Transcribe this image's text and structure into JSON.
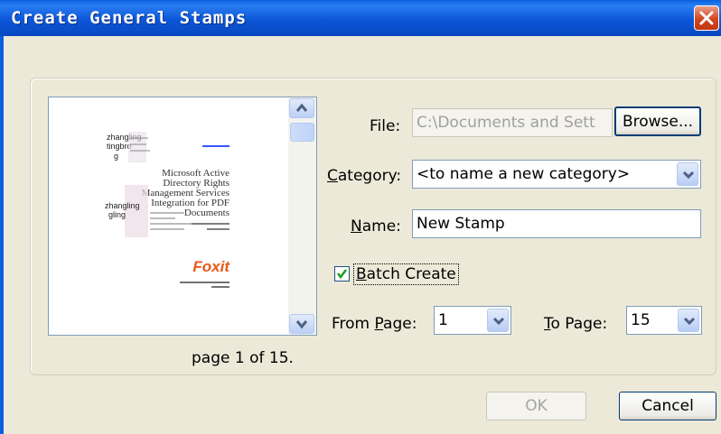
{
  "window": {
    "title": "Create General Stamps"
  },
  "preview": {
    "page_caption": "page 1 of  15.",
    "thumb_texts": {
      "name1": "zhangling",
      "name2": "tingbro",
      "name3": "g",
      "heading": [
        "Microsoft Active",
        "Directory Rights",
        "Management Services",
        "Integration for PDF",
        "Documents"
      ],
      "name4": "zhangling",
      "name5": "gling",
      "logo": "Foxit"
    }
  },
  "form": {
    "file_label": "File:",
    "file_value": "C:\\Documents and Sett",
    "browse_label": "Browse...",
    "category_label_pre": "",
    "category_label_u": "C",
    "category_label_post": "ategory:",
    "category_value": "<to name a new category>",
    "name_label_u": "N",
    "name_label_post": "ame:",
    "name_value": "New Stamp",
    "batch_label_u": "B",
    "batch_label_post": "atch Create",
    "batch_checked": true,
    "from_label_pre": "From ",
    "from_label_u": "P",
    "from_label_post": "age:",
    "from_value": "1",
    "to_label_u": "T",
    "to_label_post": "o Page:",
    "to_value": "15"
  },
  "buttons": {
    "ok": "OK",
    "cancel": "Cancel"
  },
  "colors": {
    "titlebar": "#0a5fe0",
    "dialog_bg": "#ece9d8",
    "check": "#21a121",
    "foxit": "#e8571a"
  }
}
